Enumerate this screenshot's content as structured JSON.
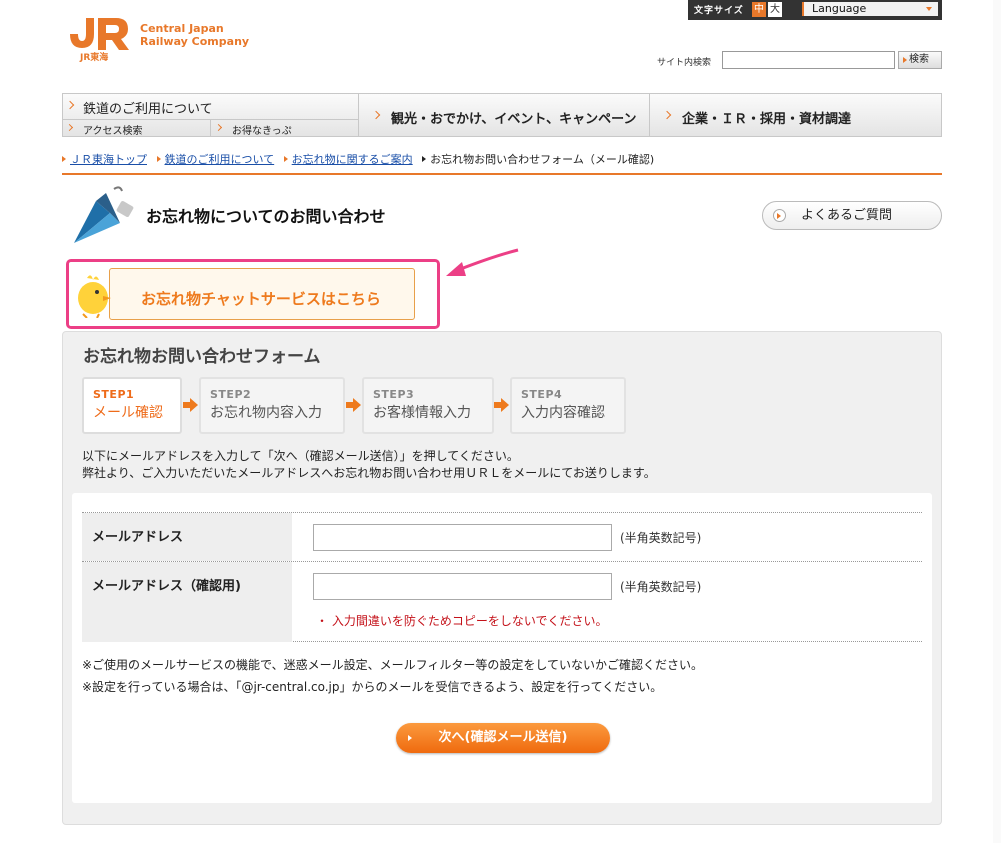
{
  "header": {
    "company_line1": "Central Japan",
    "company_line2": "Railway Company",
    "logo_sub": "JR東海",
    "text_size_label": "文字サイズ",
    "size_mid": "中",
    "size_big": "大",
    "language_label": "Language",
    "search_label": "サイト内検索",
    "search_value": "",
    "search_button": "検索"
  },
  "nav": {
    "railway": "鉄道のご利用について",
    "access": "アクセス検索",
    "tickets": "お得なきっぷ",
    "tourism": "観光・おでかけ、イベント、キャンペーン",
    "corporate": "企業・ＩＲ・採用・資材調達"
  },
  "breadcrumb": {
    "items": [
      "ＪＲ東海トップ",
      "鉄道のご利用について",
      "お忘れ物に関するご案内"
    ],
    "current": "お忘れ物お問い合わせフォーム（メール確認)"
  },
  "page": {
    "title": "お忘れ物についてのお問い合わせ",
    "faq_button": "よくあるご質問",
    "chat_banner": "お忘れ物チャットサービスはこちら"
  },
  "form": {
    "title": "お忘れ物お問い合わせフォーム",
    "steps": [
      {
        "num": "STEP1",
        "name": "メール確認",
        "active": true
      },
      {
        "num": "STEP2",
        "name": "お忘れ物内容入力",
        "active": false
      },
      {
        "num": "STEP3",
        "name": "お客様情報入力",
        "active": false
      },
      {
        "num": "STEP4",
        "name": "入力内容確認",
        "active": false
      }
    ],
    "intro_line1": "以下にメールアドレスを入力して「次へ（確認メール送信）」を押してください。",
    "intro_line2": "弊社より、ご入力いただいたメールアドレスへお忘れ物お問い合わせ用ＵＲＬをメールにてお送りします。",
    "email_label": "メールアドレス",
    "email_value": "",
    "email_note": "(半角英数記号)",
    "confirm_label": "メールアドレス（確認用)",
    "confirm_value": "",
    "confirm_note": "(半角英数記号)",
    "warning": "・ 入力間違いを防ぐためコピーをしないでください。",
    "note1": "※ご使用のメールサービスの機能で、迷惑メール設定、メールフィルター等の設定をしていないかご確認ください。",
    "note2": "※設定を行っている場合は、「@jr-central.co.jp」からのメールを受信できるよう、設定を行ってください。",
    "next_button": "次へ(確認メール送信)"
  },
  "colors": {
    "brand_orange": "#e8782a",
    "highlight_pink": "#ec3f86",
    "warning_red": "#c4121a",
    "link_blue": "#1a4fa8"
  }
}
